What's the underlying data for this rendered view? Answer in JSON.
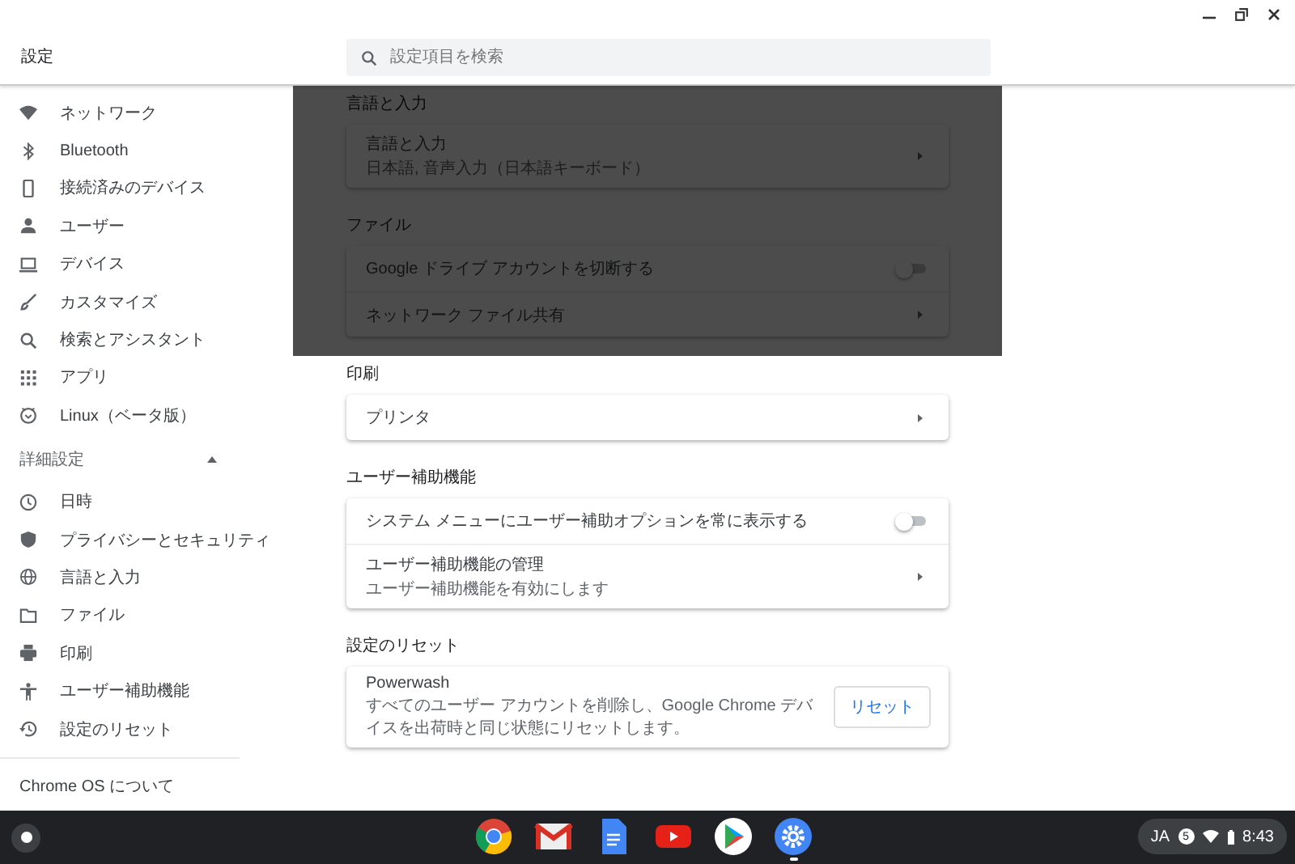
{
  "window": {
    "title": "設定"
  },
  "search": {
    "placeholder": "設定項目を検索"
  },
  "sidebar": {
    "items": [
      {
        "label": "ネットワーク"
      },
      {
        "label": "Bluetooth"
      },
      {
        "label": "接続済みのデバイス"
      },
      {
        "label": "ユーザー"
      },
      {
        "label": "デバイス"
      },
      {
        "label": "カスタマイズ"
      },
      {
        "label": "検索とアシスタント"
      },
      {
        "label": "アプリ"
      },
      {
        "label": "Linux（ベータ版）"
      }
    ],
    "advanced": {
      "label": "詳細設定",
      "expanded": true,
      "items": [
        {
          "label": "日時"
        },
        {
          "label": "プライバシーとセキュリティ"
        },
        {
          "label": "言語と入力"
        },
        {
          "label": "ファイル"
        },
        {
          "label": "印刷"
        },
        {
          "label": "ユーザー補助機能"
        },
        {
          "label": "設定のリセット"
        }
      ]
    },
    "about": "Chrome OS について"
  },
  "sections": [
    {
      "title": "言語と入力",
      "dimmed": true,
      "rows": [
        {
          "kind": "link",
          "label": "言語と入力",
          "sublabel": "日本語, 音声入力（日本語キーボード）"
        }
      ]
    },
    {
      "title": "ファイル",
      "dimmed": true,
      "rows": [
        {
          "kind": "toggle",
          "label": "Google ドライブ アカウントを切断する",
          "on": false
        },
        {
          "kind": "link",
          "label": "ネットワーク ファイル共有"
        }
      ]
    },
    {
      "title": "印刷",
      "dimmed": false,
      "rows": [
        {
          "kind": "link",
          "label": "プリンタ"
        }
      ]
    },
    {
      "title": "ユーザー補助機能",
      "dimmed": false,
      "rows": [
        {
          "kind": "toggle",
          "label": "システム メニューにユーザー補助オプションを常に表示する",
          "on": false
        },
        {
          "kind": "link",
          "label": "ユーザー補助機能の管理",
          "sublabel": "ユーザー補助機能を有効にします"
        }
      ]
    },
    {
      "title": "設定のリセット",
      "dimmed": false,
      "rows": [
        {
          "kind": "button",
          "label": "Powerwash",
          "sublabel": "すべてのユーザー アカウントを削除し、Google Chrome デバイスを出荷時と同じ状態にリセットします。",
          "button": "リセット"
        }
      ]
    }
  ],
  "shelf": {
    "apps": [
      {
        "selected": false
      },
      {
        "selected": false
      },
      {
        "selected": false
      },
      {
        "selected": false
      },
      {
        "selected": false
      },
      {
        "selected": true
      }
    ],
    "status": {
      "language": "JA",
      "badge": "5",
      "time": "8:43"
    }
  }
}
